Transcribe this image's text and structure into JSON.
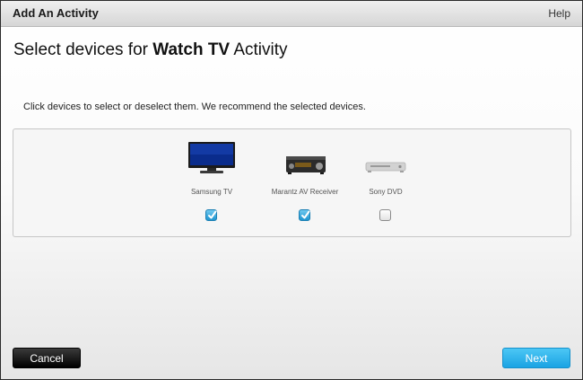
{
  "window": {
    "title": "Add An Activity",
    "help_label": "Help"
  },
  "heading": {
    "prefix": "Select devices for ",
    "activity": "Watch TV",
    "suffix": " Activity"
  },
  "instructions": "Click devices to select or deselect them. We recommend the selected devices.",
  "devices": [
    {
      "name": "Samsung TV",
      "icon": "tv-icon",
      "selected": true
    },
    {
      "name": "Marantz AV Receiver",
      "icon": "av-receiver-icon",
      "selected": true
    },
    {
      "name": "Sony DVD",
      "icon": "dvd-player-icon",
      "selected": false
    }
  ],
  "buttons": {
    "cancel_label": "Cancel",
    "next_label": "Next"
  },
  "colors": {
    "next_button": "#1aa3e3",
    "cancel_button": "#000000",
    "checkbox_checked": "#1f95cf"
  }
}
